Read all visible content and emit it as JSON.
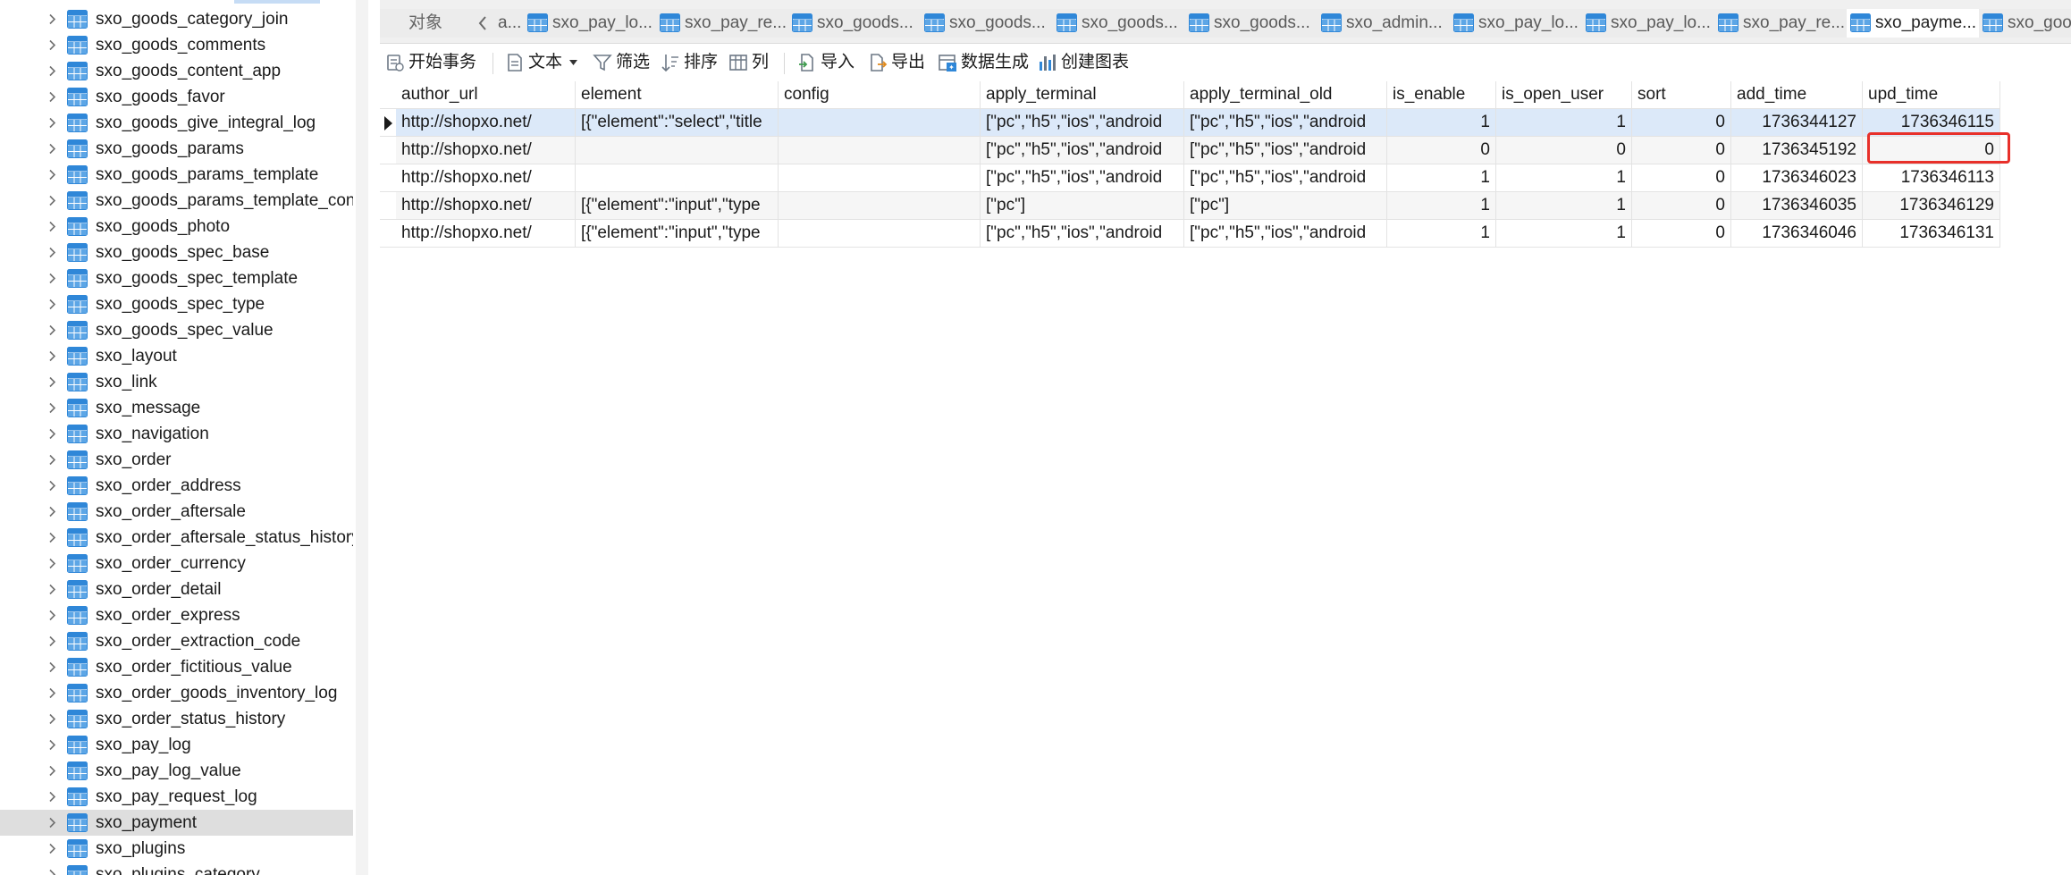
{
  "sidebar": {
    "tables": [
      {
        "name": "sxo_goods_category_join"
      },
      {
        "name": "sxo_goods_comments"
      },
      {
        "name": "sxo_goods_content_app"
      },
      {
        "name": "sxo_goods_favor"
      },
      {
        "name": "sxo_goods_give_integral_log"
      },
      {
        "name": "sxo_goods_params"
      },
      {
        "name": "sxo_goods_params_template"
      },
      {
        "name": "sxo_goods_params_template_con"
      },
      {
        "name": "sxo_goods_photo"
      },
      {
        "name": "sxo_goods_spec_base"
      },
      {
        "name": "sxo_goods_spec_template"
      },
      {
        "name": "sxo_goods_spec_type"
      },
      {
        "name": "sxo_goods_spec_value"
      },
      {
        "name": "sxo_layout"
      },
      {
        "name": "sxo_link"
      },
      {
        "name": "sxo_message"
      },
      {
        "name": "sxo_navigation"
      },
      {
        "name": "sxo_order"
      },
      {
        "name": "sxo_order_address"
      },
      {
        "name": "sxo_order_aftersale"
      },
      {
        "name": "sxo_order_aftersale_status_history"
      },
      {
        "name": "sxo_order_currency"
      },
      {
        "name": "sxo_order_detail"
      },
      {
        "name": "sxo_order_express"
      },
      {
        "name": "sxo_order_extraction_code"
      },
      {
        "name": "sxo_order_fictitious_value"
      },
      {
        "name": "sxo_order_goods_inventory_log"
      },
      {
        "name": "sxo_order_status_history"
      },
      {
        "name": "sxo_pay_log"
      },
      {
        "name": "sxo_pay_log_value"
      },
      {
        "name": "sxo_pay_request_log"
      },
      {
        "name": "sxo_payment",
        "selected": true
      },
      {
        "name": "sxo_plugins"
      },
      {
        "name": "sxo_plugins_category"
      }
    ]
  },
  "tabs": {
    "objects_label": "对象",
    "items": [
      {
        "label": "a..."
      },
      {
        "label": "sxo_pay_lo..."
      },
      {
        "label": "sxo_pay_re..."
      },
      {
        "label": "sxo_goods..."
      },
      {
        "label": "sxo_goods..."
      },
      {
        "label": "sxo_goods..."
      },
      {
        "label": "sxo_goods..."
      },
      {
        "label": "sxo_admin..."
      },
      {
        "label": "sxo_pay_lo..."
      },
      {
        "label": "sxo_pay_lo..."
      },
      {
        "label": "sxo_pay_re..."
      },
      {
        "label": "sxo_payme...",
        "active": true
      },
      {
        "label": "sxo_goods"
      }
    ]
  },
  "toolbar": {
    "begin_transaction": "开始事务",
    "text": "文本",
    "filter": "筛选",
    "sort": "排序",
    "columns": "列",
    "import": "导入",
    "export": "导出",
    "data_generation": "数据生成",
    "create_chart": "创建图表"
  },
  "grid": {
    "columns": [
      "author_url",
      "element",
      "config",
      "apply_terminal",
      "apply_terminal_old",
      "is_enable",
      "is_open_user",
      "sort",
      "add_time",
      "upd_time"
    ],
    "rows": [
      [
        "http://shopxo.net/",
        "[{\"element\":\"select\",\"title",
        "",
        "[\"pc\",\"h5\",\"ios\",\"android",
        "[\"pc\",\"h5\",\"ios\",\"android",
        "1",
        "1",
        "0",
        "1736344127",
        "1736346115"
      ],
      [
        "http://shopxo.net/",
        "",
        "",
        "[\"pc\",\"h5\",\"ios\",\"android",
        "[\"pc\",\"h5\",\"ios\",\"android",
        "0",
        "0",
        "0",
        "1736345192",
        "0"
      ],
      [
        "http://shopxo.net/",
        "",
        "",
        "[\"pc\",\"h5\",\"ios\",\"android",
        "[\"pc\",\"h5\",\"ios\",\"android",
        "1",
        "1",
        "0",
        "1736346023",
        "1736346113"
      ],
      [
        "http://shopxo.net/",
        "[{\"element\":\"input\",\"type",
        "",
        "[\"pc\"]",
        "[\"pc\"]",
        "1",
        "1",
        "0",
        "1736346035",
        "1736346129"
      ],
      [
        "http://shopxo.net/",
        "[{\"element\":\"input\",\"type",
        "",
        "[\"pc\",\"h5\",\"ios\",\"android",
        "[\"pc\",\"h5\",\"ios\",\"android",
        "1",
        "1",
        "0",
        "1736346046",
        "1736346131"
      ]
    ],
    "current_row": 0,
    "highlighted_cell": {
      "row": 1,
      "column": "upd_time"
    }
  },
  "colors": {
    "accent": "#2f87d8",
    "highlight_box": "#e8302a",
    "selected_row": "#dce9f9",
    "sidebar_selected": "#dedede"
  },
  "icons": {
    "table": "table-icon",
    "chevron": "chevron-right-icon"
  }
}
